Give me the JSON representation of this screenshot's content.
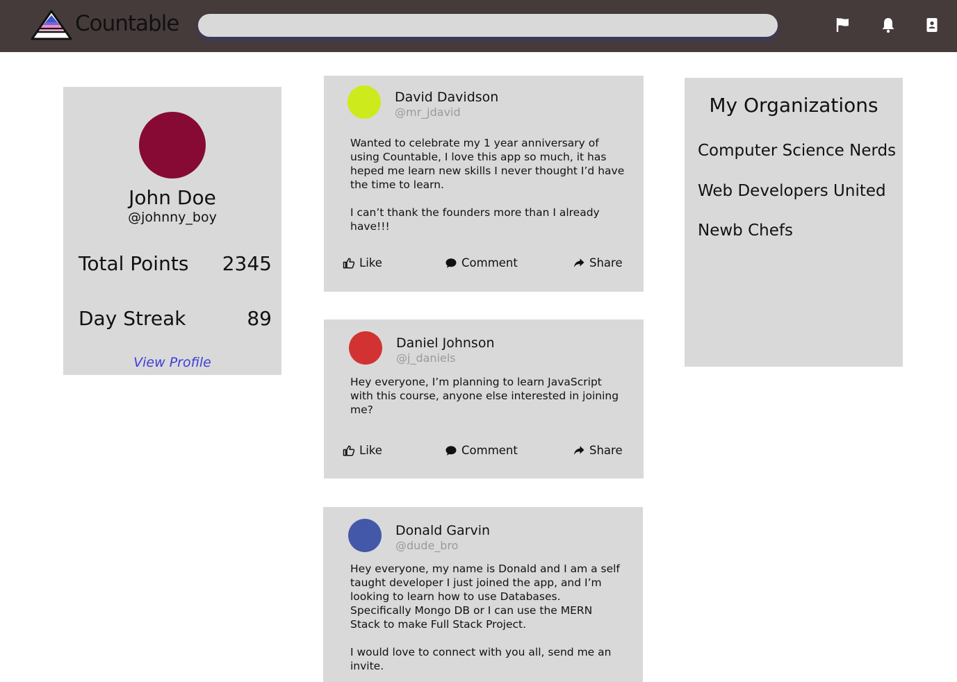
{
  "header": {
    "brand": "Countable",
    "search_placeholder": "",
    "icons": [
      "flag-icon",
      "bell-icon",
      "contact-book-icon"
    ]
  },
  "profile": {
    "name": "John Doe",
    "handle": "@johnny_boy",
    "stats": [
      {
        "label": "Total Points",
        "value": "2345"
      },
      {
        "label": "Day Streak",
        "value": "89"
      }
    ],
    "link": "View Profile",
    "avatar_color": "#860a33"
  },
  "posts": [
    {
      "name": "David Davidson",
      "handle": "@mr_jdavid",
      "avatar_color": "#cdea1c",
      "body": "Wanted to celebrate my 1 year anniversary of using Countable, I love this app so much, it has heped me learn new skills I never thought I’d have the time to learn.\n\nI can’t thank the founders more than I already have!!!"
    },
    {
      "name": "Daniel Johnson",
      "handle": "@j_daniels",
      "avatar_color": "#d33232",
      "body": "Hey everyone, I’m planning to learn JavaScript with this course, anyone else interested in joining me?"
    },
    {
      "name": "Donald Garvin",
      "handle": "@dude_bro",
      "avatar_color": "#4358a8",
      "body": "Hey everyone, my name is Donald and I am a self taught developer I just joined the app, and I’m looking to learn how to use Databases. Specifically Mongo DB or I can use the MERN Stack to make Full Stack Project.\n\nI would love to connect with you all, send me an invite."
    }
  ],
  "actions": {
    "like": "Like",
    "comment": "Comment",
    "share": "Share"
  },
  "organizations": {
    "title": "My Organizations",
    "items": [
      "Computer Science Nerds",
      "Web Developers United",
      "Newb Chefs"
    ]
  }
}
